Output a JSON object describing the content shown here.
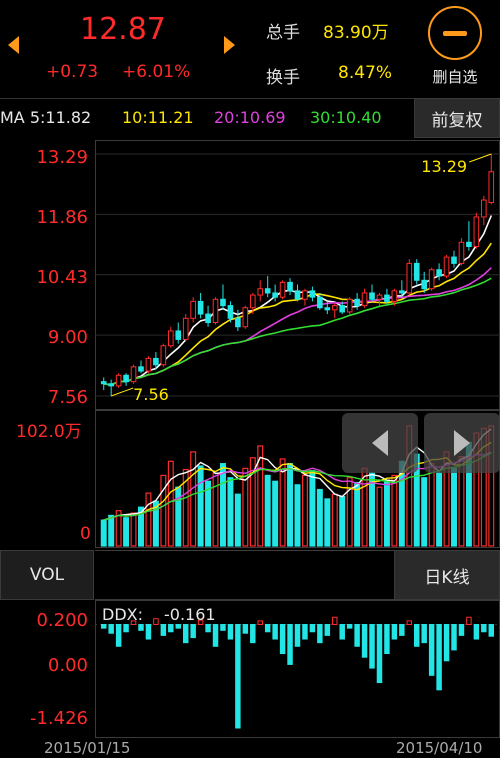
{
  "header": {
    "price": "12.87",
    "change": "+0.73",
    "change_pct": "+6.01%",
    "total_volume_label": "总手",
    "total_volume_value": "83.90万",
    "turnover_label": "换手",
    "turnover_value": "8.47%",
    "remove_watchlist_label": "删自选",
    "adjust_button_label": "前复权"
  },
  "ma": {
    "ma5": "MA 5:11.82",
    "ma10": "10:11.21",
    "ma20": "20:10.69",
    "ma30": "30:10.40"
  },
  "buttons": {
    "vol_label": "VOL",
    "daily_k_label": "日K线"
  },
  "ddx": {
    "label": "DDX:",
    "value": "-0.161"
  },
  "axes": {
    "price_ticks": [
      "13.29",
      "11.86",
      "10.43",
      "9.00",
      "7.56"
    ],
    "vol_top": "102.0万",
    "vol_zero": "0",
    "ddx_ticks": [
      "0.200",
      "0.00",
      "-1.426"
    ],
    "date_start": "2015/01/15",
    "date_end": "2015/04/10"
  },
  "colors": {
    "up": "#ff2b2b",
    "down": "#22e5e5",
    "ma5": "#ffffff",
    "ma10": "#ffe600",
    "ma20": "#e040e0",
    "ma30": "#33dd33",
    "accent": "#ff9a1a"
  },
  "icons": {
    "prev": "chevron-left-icon",
    "next": "chevron-right-icon",
    "remove": "minus-circle-icon"
  },
  "chart_data": [
    {
      "type": "candlestick",
      "title": "日K线",
      "ylim": [
        7.56,
        13.29
      ],
      "y_ticks": [
        13.29,
        11.86,
        10.43,
        9.0,
        7.56
      ],
      "annotations": [
        {
          "label": "13.29",
          "kind": "high"
        },
        {
          "label": "7.56",
          "kind": "low"
        }
      ],
      "candles": [
        {
          "o": 7.9,
          "h": 8.0,
          "l": 7.7,
          "c": 7.85
        },
        {
          "o": 7.85,
          "h": 7.95,
          "l": 7.56,
          "c": 7.8
        },
        {
          "o": 7.8,
          "h": 8.1,
          "l": 7.75,
          "c": 8.05
        },
        {
          "o": 8.05,
          "h": 8.1,
          "l": 7.8,
          "c": 7.9
        },
        {
          "o": 7.9,
          "h": 8.3,
          "l": 7.85,
          "c": 8.25
        },
        {
          "o": 8.25,
          "h": 8.4,
          "l": 8.1,
          "c": 8.15
        },
        {
          "o": 8.15,
          "h": 8.5,
          "l": 8.1,
          "c": 8.45
        },
        {
          "o": 8.45,
          "h": 8.6,
          "l": 8.2,
          "c": 8.3
        },
        {
          "o": 8.3,
          "h": 8.8,
          "l": 8.25,
          "c": 8.75
        },
        {
          "o": 8.75,
          "h": 9.2,
          "l": 8.7,
          "c": 9.1
        },
        {
          "o": 9.1,
          "h": 9.3,
          "l": 8.8,
          "c": 8.9
        },
        {
          "o": 8.9,
          "h": 9.5,
          "l": 8.85,
          "c": 9.4
        },
        {
          "o": 9.4,
          "h": 9.9,
          "l": 9.3,
          "c": 9.8
        },
        {
          "o": 9.8,
          "h": 10.0,
          "l": 9.4,
          "c": 9.5
        },
        {
          "o": 9.5,
          "h": 9.7,
          "l": 9.2,
          "c": 9.3
        },
        {
          "o": 9.3,
          "h": 9.9,
          "l": 9.25,
          "c": 9.85
        },
        {
          "o": 9.85,
          "h": 10.2,
          "l": 9.6,
          "c": 9.7
        },
        {
          "o": 9.7,
          "h": 9.8,
          "l": 9.3,
          "c": 9.4
        },
        {
          "o": 9.4,
          "h": 9.6,
          "l": 9.1,
          "c": 9.2
        },
        {
          "o": 9.2,
          "h": 9.7,
          "l": 9.15,
          "c": 9.65
        },
        {
          "o": 9.65,
          "h": 10.0,
          "l": 9.5,
          "c": 9.95
        },
        {
          "o": 9.95,
          "h": 10.3,
          "l": 9.8,
          "c": 10.1
        },
        {
          "o": 10.1,
          "h": 10.4,
          "l": 9.9,
          "c": 10.0
        },
        {
          "o": 10.0,
          "h": 10.2,
          "l": 9.8,
          "c": 9.9
        },
        {
          "o": 9.9,
          "h": 10.3,
          "l": 9.85,
          "c": 10.25
        },
        {
          "o": 10.25,
          "h": 10.35,
          "l": 9.95,
          "c": 10.05
        },
        {
          "o": 10.05,
          "h": 10.2,
          "l": 9.8,
          "c": 9.85
        },
        {
          "o": 9.85,
          "h": 10.1,
          "l": 9.7,
          "c": 10.05
        },
        {
          "o": 10.05,
          "h": 10.15,
          "l": 9.8,
          "c": 9.9
        },
        {
          "o": 9.9,
          "h": 10.0,
          "l": 9.6,
          "c": 9.65
        },
        {
          "o": 9.65,
          "h": 9.8,
          "l": 9.5,
          "c": 9.6
        },
        {
          "o": 9.6,
          "h": 9.75,
          "l": 9.4,
          "c": 9.7
        },
        {
          "o": 9.7,
          "h": 9.8,
          "l": 9.5,
          "c": 9.55
        },
        {
          "o": 9.55,
          "h": 9.9,
          "l": 9.5,
          "c": 9.85
        },
        {
          "o": 9.85,
          "h": 10.0,
          "l": 9.6,
          "c": 9.7
        },
        {
          "o": 9.7,
          "h": 10.1,
          "l": 9.65,
          "c": 10.0
        },
        {
          "o": 10.0,
          "h": 10.2,
          "l": 9.8,
          "c": 9.85
        },
        {
          "o": 9.85,
          "h": 10.0,
          "l": 9.7,
          "c": 9.95
        },
        {
          "o": 9.95,
          "h": 10.1,
          "l": 9.75,
          "c": 9.8
        },
        {
          "o": 9.8,
          "h": 10.1,
          "l": 9.7,
          "c": 10.05
        },
        {
          "o": 10.05,
          "h": 10.3,
          "l": 9.9,
          "c": 10.0
        },
        {
          "o": 10.0,
          "h": 10.8,
          "l": 9.95,
          "c": 10.7
        },
        {
          "o": 10.7,
          "h": 10.8,
          "l": 10.2,
          "c": 10.3
        },
        {
          "o": 10.3,
          "h": 10.5,
          "l": 10.0,
          "c": 10.1
        },
        {
          "o": 10.1,
          "h": 10.6,
          "l": 10.05,
          "c": 10.55
        },
        {
          "o": 10.55,
          "h": 10.7,
          "l": 10.3,
          "c": 10.4
        },
        {
          "o": 10.4,
          "h": 10.9,
          "l": 10.35,
          "c": 10.85
        },
        {
          "o": 10.85,
          "h": 11.0,
          "l": 10.6,
          "c": 10.7
        },
        {
          "o": 10.7,
          "h": 11.3,
          "l": 10.65,
          "c": 11.2
        },
        {
          "o": 11.2,
          "h": 11.7,
          "l": 11.0,
          "c": 11.1
        },
        {
          "o": 11.1,
          "h": 11.9,
          "l": 11.05,
          "c": 11.8
        },
        {
          "o": 11.8,
          "h": 12.3,
          "l": 11.6,
          "c": 12.2
        },
        {
          "o": 12.14,
          "h": 13.29,
          "l": 12.1,
          "c": 12.87
        }
      ],
      "ma_series": [
        {
          "name": "MA 5",
          "current": 11.82
        },
        {
          "name": "10",
          "current": 11.21
        },
        {
          "name": "20",
          "current": 10.69
        },
        {
          "name": "30",
          "current": 10.4
        }
      ]
    },
    {
      "type": "bar",
      "title": "VOL",
      "ylim": [
        0,
        102.0
      ],
      "unit": "万",
      "values": [
        22,
        26,
        30,
        24,
        28,
        33,
        45,
        38,
        60,
        72,
        50,
        65,
        80,
        68,
        55,
        62,
        70,
        58,
        44,
        66,
        75,
        85,
        60,
        55,
        74,
        70,
        52,
        60,
        64,
        48,
        40,
        44,
        42,
        58,
        54,
        66,
        62,
        50,
        56,
        60,
        72,
        102,
        78,
        58,
        70,
        62,
        80,
        66,
        76,
        88,
        96,
        100,
        102
      ],
      "up": [
        false,
        false,
        true,
        false,
        true,
        false,
        true,
        false,
        true,
        true,
        false,
        true,
        true,
        false,
        false,
        true,
        false,
        false,
        false,
        true,
        true,
        true,
        false,
        false,
        true,
        false,
        false,
        true,
        false,
        false,
        false,
        true,
        false,
        true,
        false,
        true,
        false,
        true,
        false,
        true,
        false,
        true,
        false,
        false,
        true,
        false,
        true,
        false,
        true,
        false,
        true,
        true,
        true
      ]
    },
    {
      "type": "bar",
      "title": "DDX",
      "ylim": [
        -1.426,
        0.2
      ],
      "y_ticks": [
        0.2,
        0.0,
        -1.426
      ],
      "current": -0.161,
      "values": [
        -0.05,
        -0.12,
        -0.3,
        -0.1,
        0.05,
        -0.08,
        -0.2,
        0.08,
        -0.15,
        -0.1,
        -0.05,
        -0.25,
        -0.18,
        0.06,
        -0.1,
        -0.3,
        -0.08,
        -0.2,
        -1.426,
        -0.12,
        -0.25,
        0.05,
        -0.1,
        -0.2,
        -0.4,
        -0.55,
        -0.3,
        -0.2,
        -0.1,
        -0.25,
        -0.15,
        0.1,
        -0.2,
        -0.05,
        -0.3,
        -0.45,
        -0.6,
        -0.8,
        -0.4,
        -0.2,
        -0.15,
        0.05,
        -0.3,
        -0.25,
        -0.7,
        -0.9,
        -0.5,
        -0.35,
        -0.15,
        0.1,
        -0.2,
        -0.1,
        -0.161
      ]
    }
  ]
}
